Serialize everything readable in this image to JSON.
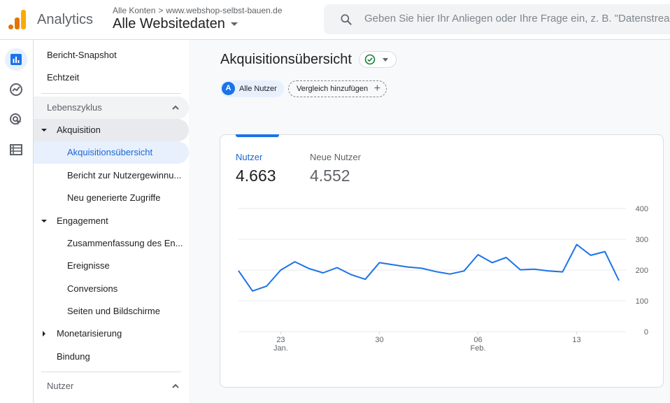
{
  "header": {
    "app_name": "Analytics",
    "breadcrumb_root": "Alle Konten",
    "breadcrumb_sep": ">",
    "breadcrumb_domain": "www.webshop-selbst-bauen.de",
    "property_name": "Alle Websitedaten",
    "search_placeholder": "Geben Sie hier Ihr Anliegen oder Ihre Frage ein, z. B. \"Datenstream\"",
    "colors": {
      "logo_dark": "#e37400",
      "logo_light": "#f9ab00",
      "accent": "#1a73e8"
    }
  },
  "rail": {
    "items": [
      {
        "icon": "reports-icon",
        "active": true
      },
      {
        "icon": "explore-icon",
        "active": false
      },
      {
        "icon": "advertising-icon",
        "active": false
      },
      {
        "icon": "configure-icon",
        "active": false
      }
    ]
  },
  "nav": {
    "snapshot": "Bericht-Snapshot",
    "realtime": "Echtzeit",
    "lifecycle": "Lebenszyklus",
    "acquisition": "Akquisition",
    "acq_overview": "Akquisitionsübersicht",
    "user_acq": "Bericht zur Nutzergewinnu...",
    "traffic_acq": "Neu generierte Zugriffe",
    "engagement": "Engagement",
    "eng_overview": "Zusammenfassung des En...",
    "events": "Ereignisse",
    "conversions": "Conversions",
    "pages": "Seiten und Bildschirme",
    "monetization": "Monetarisierung",
    "retention": "Bindung",
    "user": "Nutzer"
  },
  "main": {
    "title": "Akquisitionsübersicht",
    "segment_badge": "A",
    "segment_label": "Alle Nutzer",
    "compare_label": "Vergleich hinzufügen",
    "compare_plus": "+",
    "metrics": [
      {
        "label": "Nutzer",
        "value": "4.663",
        "selected": true
      },
      {
        "label": "Neue Nutzer",
        "value": "4.552",
        "selected": false
      }
    ]
  },
  "chart_data": {
    "type": "line",
    "series": [
      {
        "values": [
          198,
          132,
          148,
          200,
          227,
          205,
          191,
          208,
          185,
          170,
          224,
          217,
          210,
          206,
          195,
          187,
          197,
          250,
          224,
          241,
          201,
          203,
          197,
          194,
          283,
          248,
          260,
          166
        ]
      }
    ],
    "x_ticks": [
      {
        "index": 3,
        "label": "23",
        "sub": "Jan."
      },
      {
        "index": 10,
        "label": "30",
        "sub": ""
      },
      {
        "index": 17,
        "label": "06",
        "sub": "Feb."
      },
      {
        "index": 24,
        "label": "13",
        "sub": ""
      }
    ],
    "y_ticks": [
      "400",
      "300",
      "200",
      "100",
      "0"
    ],
    "ylim": [
      0,
      400
    ],
    "grid": true,
    "line_color": "#1a73e8"
  }
}
